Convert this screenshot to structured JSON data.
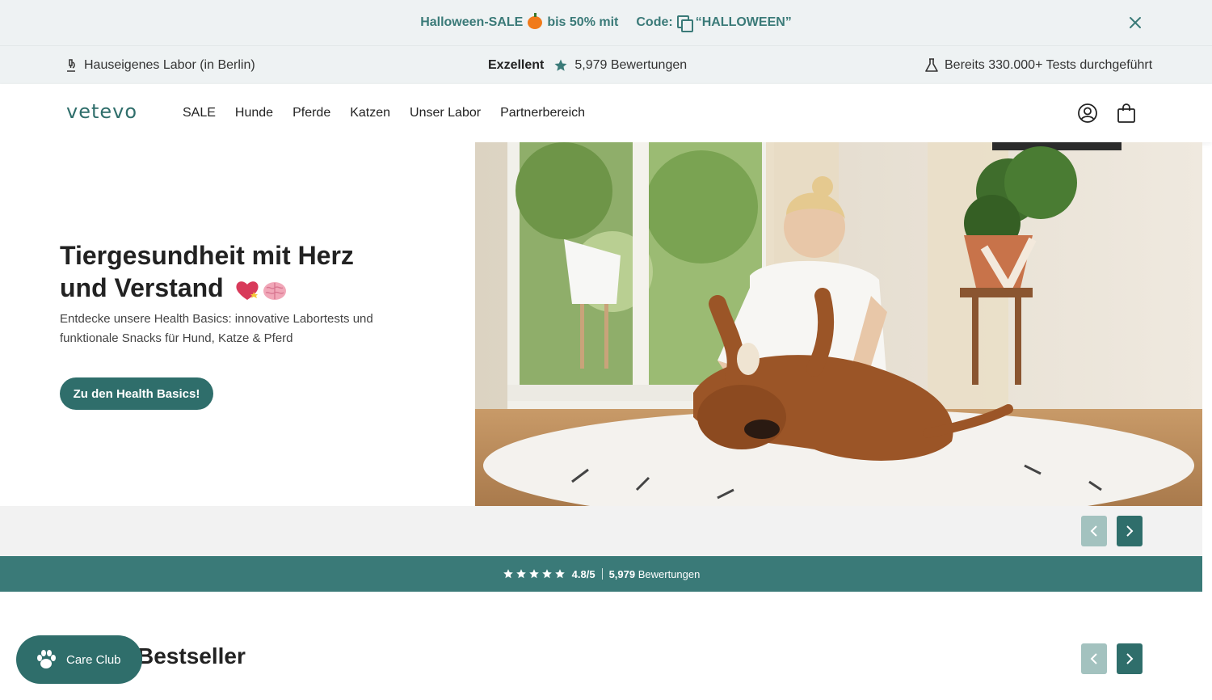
{
  "promo": {
    "sale_text": "Halloween-SALE",
    "sale_suffix": "bis 50% mit",
    "code_label": "Code:",
    "code_value": "“HALLOWEEN”",
    "icons": [
      "pumpkin-icon",
      "copy-icon",
      "close-icon"
    ]
  },
  "trust": {
    "lab": "Hauseigenes Labor (in Berlin)",
    "rating_label": "Exzellent",
    "rating_count": "5,979 Bewertungen",
    "tests": "Bereits 330.000+ Tests durchgeführt"
  },
  "header": {
    "logo": "vetevo",
    "nav": [
      "SALE",
      "Hunde",
      "Pferde",
      "Katzen",
      "Unser Labor",
      "Partnerbereich"
    ]
  },
  "hero": {
    "title": "Tiergesundheit mit Herz und Verstand",
    "subtitle": "Entdecke unsere Health Basics: innovative Labortests und funktionale Snacks für Hund, Katze & Pferd",
    "cta": "Zu den Health Basics!"
  },
  "rating_strip": {
    "score": "4.8/5",
    "count": "5,979",
    "count_label": "Bewertungen",
    "stars": 5
  },
  "bestseller": {
    "title": "Bestseller"
  },
  "care_club": {
    "label": "Care Club"
  },
  "colors": {
    "brand": "#2f6e6b",
    "strip": "#3a7a78",
    "promo_bg": "#eef2f3"
  }
}
